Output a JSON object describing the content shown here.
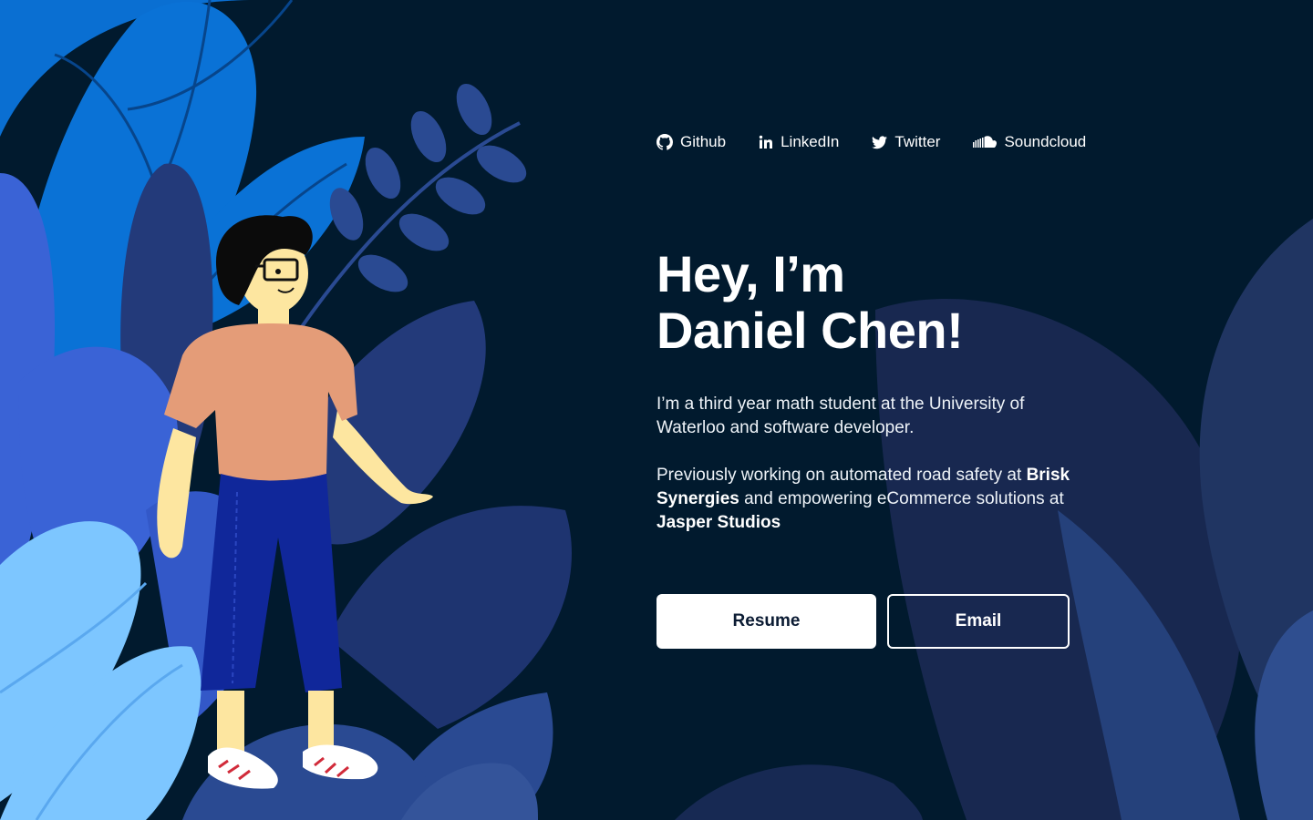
{
  "nav": {
    "links": [
      {
        "label": "Github",
        "icon": "github-icon"
      },
      {
        "label": "LinkedIn",
        "icon": "linkedin-icon"
      },
      {
        "label": "Twitter",
        "icon": "twitter-icon"
      },
      {
        "label": "Soundcloud",
        "icon": "soundcloud-icon"
      }
    ]
  },
  "hero": {
    "line1": "Hey, I’m",
    "line2": "Daniel Chen!"
  },
  "bio": {
    "p1": "I’m a third year math student at the University of Waterloo and software developer.",
    "p2_before": "Previously working on automated road safety at ",
    "p2_company1": "Brisk Synergies",
    "p2_middle": " and empowering eCommerce solutions at ",
    "p2_company2": "Jasper Studios"
  },
  "actions": {
    "resume_label": "Resume",
    "email_label": "Email"
  },
  "colors": {
    "background": "#011a2e",
    "leaf_bright_blue": "#0a72d6",
    "leaf_navy": "#2a3b78",
    "leaf_light_blue": "#7dc6ff",
    "shirt": "#e49c78",
    "jeans": "#10279a",
    "skin": "#fde6a0"
  }
}
